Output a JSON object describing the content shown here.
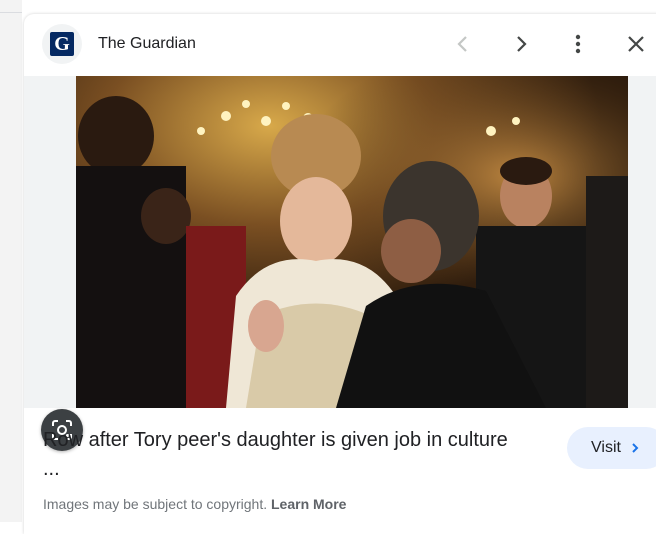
{
  "header": {
    "favicon_letter": "G",
    "source_name": "The Guardian",
    "icons": [
      "chevron-left-icon",
      "chevron-right-icon",
      "more-vert-icon",
      "close-icon"
    ]
  },
  "media": {
    "lens_icon": "google-lens-icon"
  },
  "result": {
    "title": "Row after Tory peer's daughter is given job in culture ...",
    "visit_label": "Visit",
    "copyright_text": "Images may be subject to copyright.",
    "learn_more_label": "Learn More"
  },
  "colors": {
    "favicon_bg": "#052962",
    "visit_bg": "#e8f0fe",
    "lens_bg": "#3c4043"
  }
}
